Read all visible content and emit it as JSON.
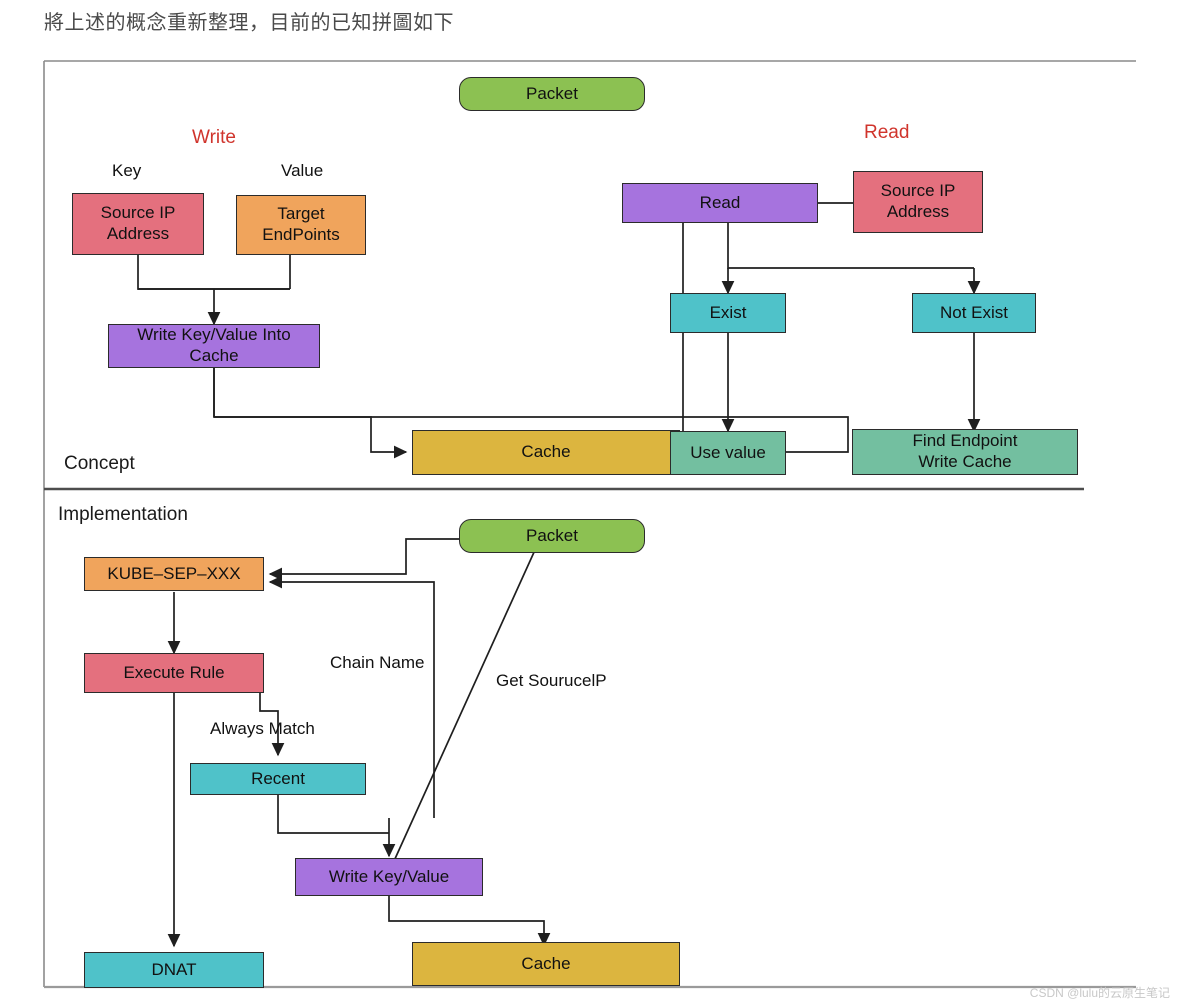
{
  "page": {
    "title": "將上述的概念重新整理，目前的已知拼圖如下",
    "watermark": "CSDN @lulu的云原生笔记"
  },
  "colors": {
    "green": "#8CC152",
    "red_pink": "#E4707E",
    "orange": "#F0A45C",
    "purple": "#A673DE",
    "gold": "#DCB53F",
    "cyan": "#4FC2C9",
    "seagreen": "#73BFA0",
    "stroke": "#2b2b2b",
    "accent_red": "#d0342c"
  },
  "sections": [
    {
      "id": "concept",
      "label": "Concept"
    },
    {
      "id": "implementation",
      "label": "Implementation"
    }
  ],
  "concept": {
    "section_label": "Concept",
    "group_labels": [
      {
        "id": "write",
        "text": "Write"
      },
      {
        "id": "read",
        "text": "Read"
      }
    ],
    "field_labels": [
      {
        "id": "key",
        "text": "Key"
      },
      {
        "id": "value",
        "text": "Value"
      }
    ],
    "nodes": [
      {
        "id": "packet",
        "text": "Packet",
        "color": "green",
        "shape": "rounded"
      },
      {
        "id": "source-ip-write",
        "text": "Source IP\nAddress",
        "color": "red_pink"
      },
      {
        "id": "target-endpoints",
        "text": "Target\nEndPoints",
        "color": "orange"
      },
      {
        "id": "write-kv-into-cache",
        "text": "Write Key/Value Into\nCache",
        "color": "purple"
      },
      {
        "id": "read",
        "text": "Read",
        "color": "purple"
      },
      {
        "id": "source-ip-read",
        "text": "Source IP\nAddress",
        "color": "red_pink"
      },
      {
        "id": "exist",
        "text": "Exist",
        "color": "cyan"
      },
      {
        "id": "not-exist",
        "text": "Not Exist",
        "color": "cyan"
      },
      {
        "id": "cache",
        "text": "Cache",
        "color": "gold"
      },
      {
        "id": "use-value",
        "text": "Use value",
        "color": "seagreen"
      },
      {
        "id": "find-endpoint",
        "text": "Find Endpoint\nWrite Cache",
        "color": "seagreen"
      }
    ]
  },
  "implementation": {
    "section_label": "Implementation",
    "edge_labels": [
      {
        "id": "chain-name",
        "text": "Chain Name"
      },
      {
        "id": "always-match",
        "text": "Always Match"
      },
      {
        "id": "get-sourceip",
        "text": "Get SourucelP"
      }
    ],
    "nodes": [
      {
        "id": "packet",
        "text": "Packet",
        "color": "green",
        "shape": "rounded"
      },
      {
        "id": "kube-sep-xxx",
        "text": "KUBE–SEP–XXX",
        "color": "orange"
      },
      {
        "id": "execute-rule",
        "text": "Execute Rule",
        "color": "red_pink"
      },
      {
        "id": "recent",
        "text": "Recent",
        "color": "cyan"
      },
      {
        "id": "write-key-value",
        "text": "Write Key/Value",
        "color": "purple"
      },
      {
        "id": "dnat",
        "text": "DNAT",
        "color": "cyan"
      },
      {
        "id": "cache",
        "text": "Cache",
        "color": "gold"
      }
    ]
  }
}
